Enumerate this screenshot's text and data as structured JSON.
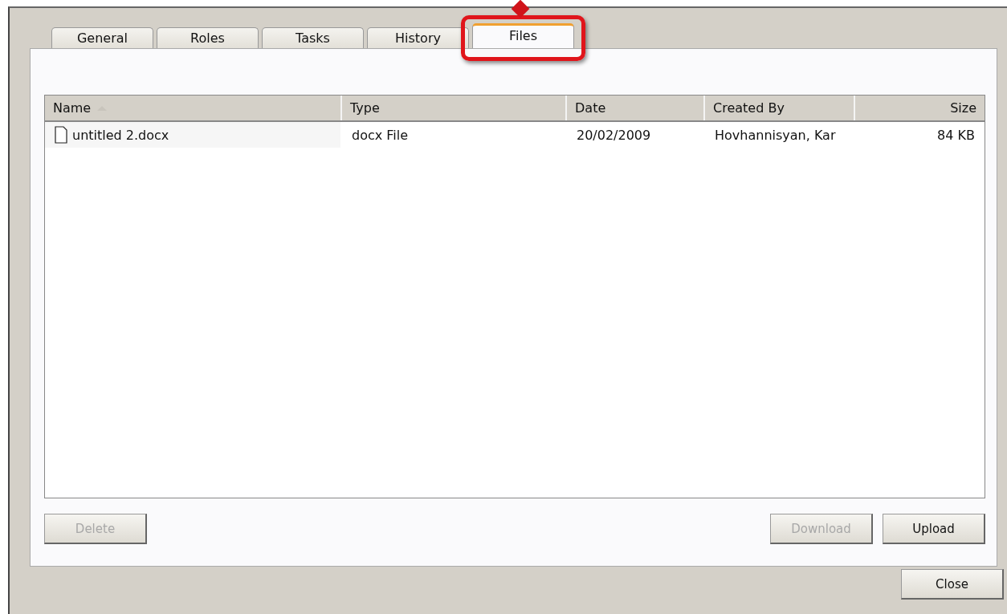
{
  "tabs": [
    {
      "label": "General",
      "selected": false
    },
    {
      "label": "Roles",
      "selected": false
    },
    {
      "label": "Tasks",
      "selected": false
    },
    {
      "label": "History",
      "selected": false
    },
    {
      "label": "Files",
      "selected": true,
      "highlighted": true
    }
  ],
  "table": {
    "columns": [
      {
        "label": "Name",
        "sorted": true
      },
      {
        "label": "Type",
        "sorted": false
      },
      {
        "label": "Date",
        "sorted": false
      },
      {
        "label": "Created By",
        "sorted": false
      },
      {
        "label": "Size",
        "sorted": false
      }
    ],
    "rows": [
      {
        "cells": [
          "untitled 2.docx",
          "docx File",
          "20/02/2009",
          "Hovhannisyan, Kar",
          "84 KB"
        ]
      }
    ]
  },
  "buttons": [
    {
      "label": "Delete",
      "disabled": true
    },
    {
      "label": "Download",
      "disabled": true
    },
    {
      "label": "Upload",
      "disabled": false
    }
  ],
  "close_button": {
    "label": "Close"
  }
}
